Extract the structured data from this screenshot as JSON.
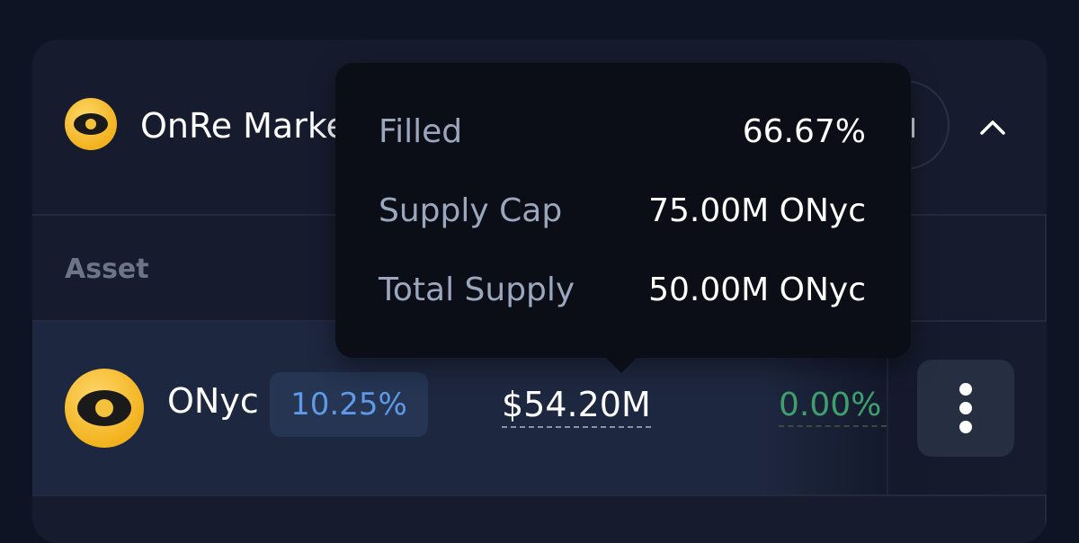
{
  "market": {
    "name": "OnRe Market",
    "logo_icon": "onre-eye-logo-icon"
  },
  "table": {
    "columns": [
      "Asset"
    ]
  },
  "row": {
    "symbol": "ONyc",
    "apy": "10.25%",
    "total": "$54.20M",
    "change": "0.00%",
    "more_icon": "vertical-dots-icon"
  },
  "tooltip": {
    "items": [
      {
        "label": "Filled",
        "value": "66.67%"
      },
      {
        "label": "Supply Cap",
        "value": "75.00M ONyc"
      },
      {
        "label": "Total Supply",
        "value": "50.00M ONyc"
      }
    ]
  },
  "colors": {
    "background": "#0f1424",
    "card": "#161c2e",
    "tooltip": "#0b0e17",
    "accent_blue": "#5e9ae8",
    "positive_green": "#3f9f6d",
    "logo_yellow": "#f2b21d"
  }
}
